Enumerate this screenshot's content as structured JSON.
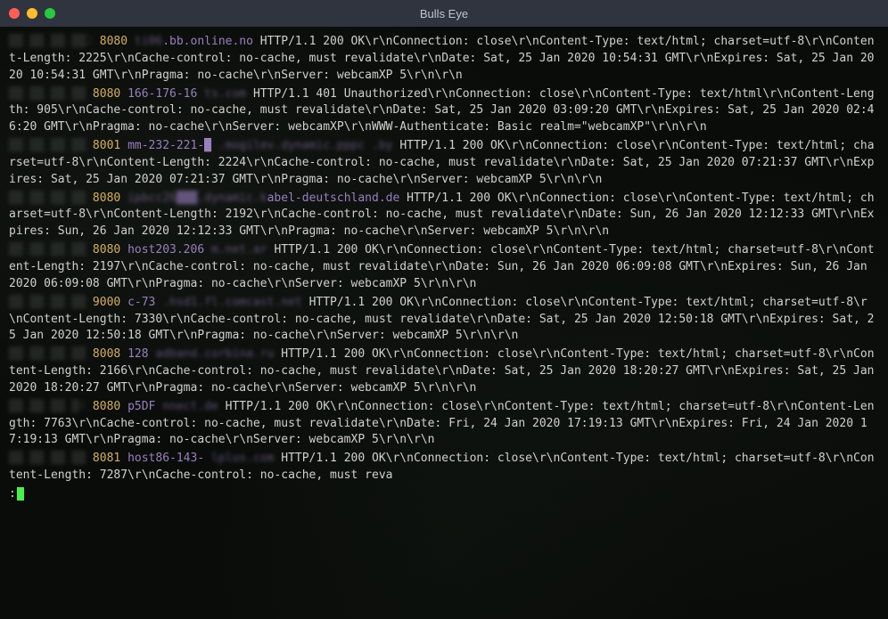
{
  "window": {
    "title": "Bulls Eye"
  },
  "entries": [
    {
      "ip": "██.██.██.██2",
      "port": "8080",
      "host_blur": "ti06",
      "host_clear": ".bb.online.no",
      "host_pad": "            ",
      "response": "HTTP/1.1 200 OK\\r\\nConnection: close\\r\\nContent-Type: text/html; charset=utf-8\\r\\nContent-Length: 2225\\r\\nCache-control: no-cache, must revalidate\\r\\nDate: Sat, 25 Jan 2020 10:54:31 GMT\\r\\nExpires: Sat, 25 Jan 2020 10:54:31 GMT\\r\\nPragma: no-cache\\r\\nServer: webcamXP 5\\r\\n\\r\\n"
    },
    {
      "ip": "██.██.██.██ ",
      "port": "8080",
      "host_blur": "",
      "host_clear": "166-176-16",
      "host_pad": "          ts.com        ",
      "response": "HTTP/1.1 401 Unauthorized\\r\\nConnection: close\\r\\nContent-Type: text/html\\r\\nContent-Length: 905\\r\\nCache-control: no-cache, must revalidate\\r\\nDate: Sat, 25 Jan 2020 03:09:20 GMT\\r\\nExpires: Sat, 25 Jan 2020 02:46:20 GMT\\r\\nPragma: no-cache\\r\\nServer: webcamXP\\r\\nWWW-Authenticate: Basic realm=\"webcamXP\"\\r\\n\\r\\n"
    },
    {
      "ip": "██.██.██.██ ",
      "port": "8001",
      "host_blur": "",
      "host_clear": "mm-232-221-█",
      "host_pad": "    .mogilev.dynamic.pppc      .by ",
      "response": "HTTP/1.1 200 OK\\r\\nConnection: close\\r\\nContent-Type: text/html; charset=utf-8\\r\\nContent-Length: 2224\\r\\nCache-control: no-cache, must revalidate\\r\\nDate: Sat, 25 Jan 2020 07:21:37 GMT\\r\\nExpires: Sat, 25 Jan 2020 07:21:37 GMT\\r\\nPragma: no-cache\\r\\nServer: webcamXP 5\\r\\n\\r\\n"
    },
    {
      "ip": "██.██.██.██ ",
      "port": "8080",
      "host_blur": "ipbcc26███.dynamic.k",
      "host_clear": "abel-deutschland.de ",
      "host_pad": "",
      "response": "HTTP/1.1 200 OK\\r\\nConnection: close\\r\\nContent-Type: text/html; charset=utf-8\\r\\nContent-Length: 2192\\r\\nCache-control: no-cache, must revalidate\\r\\nDate: Sun, 26 Jan 2020 12:12:33 GMT\\r\\nExpires: Sun, 26 Jan 2020 12:12:33 GMT\\r\\nPragma: no-cache\\r\\nServer: webcamXP 5\\r\\n\\r\\n"
    },
    {
      "ip": "██.██.██.██ ",
      "port": "8080",
      "host_blur": "",
      "host_clear": "host203.206",
      "host_pad": "          m.net.ar            ",
      "response": "HTTP/1.1 200 OK\\r\\nConnection: close\\r\\nContent-Type: text/html; charset=utf-8\\r\\nContent-Length: 2197\\r\\nCache-control: no-cache, must revalidate\\r\\nDate: Sun, 26 Jan 2020 06:09:08 GMT\\r\\nExpires: Sun, 26 Jan 2020 06:09:08 GMT\\r\\nPragma: no-cache\\r\\nServer: webcamXP 5\\r\\n\\r\\n"
    },
    {
      "ip": "██.██.██.██ ",
      "port": "9000",
      "host_blur": "",
      "host_clear": "c-73",
      "host_pad": "        .hsd1.fl.comcast.net       ",
      "response": "HTTP/1.1 200 OK\\r\\nConnection: close\\r\\nContent-Type: text/html; charset=utf-8\\r\\nContent-Length: 7330\\r\\nCache-control: no-cache, must revalidate\\r\\nDate: Sat, 25 Jan 2020 12:50:18 GMT\\r\\nExpires: Sat, 25 Jan 2020 12:50:18 GMT\\r\\nPragma: no-cache\\r\\nServer: webcamXP 5\\r\\n\\r\\n"
    },
    {
      "ip": "██.██.██.██ ",
      "port": "8008",
      "host_blur": "",
      "host_clear": "128",
      "host_pad": "           adband.corbina.ru        ",
      "response": "HTTP/1.1 200 OK\\r\\nConnection: close\\r\\nContent-Type: text/html; charset=utf-8\\r\\nContent-Length: 2166\\r\\nCache-control: no-cache, must revalidate\\r\\nDate: Sat, 25 Jan 2020 18:20:27 GMT\\r\\nExpires: Sat, 25 Jan 2020 18:20:27 GMT\\r\\nPragma: no-cache\\r\\nServer: webcamXP 5\\r\\n\\r\\n"
    },
    {
      "ip": "██.██.██.█0 ",
      "port": "8080",
      "host_blur": "",
      "host_clear": "p5DF",
      "host_pad": "              nnect.de       ",
      "response": "HTTP/1.1 200 OK\\r\\nConnection: close\\r\\nContent-Type: text/html; charset=utf-8\\r\\nContent-Length: 7763\\r\\nCache-control: no-cache, must revalidate\\r\\nDate: Fri, 24 Jan 2020 17:19:13 GMT\\r\\nExpires: Fri, 24 Jan 2020 17:19:13 GMT\\r\\nPragma: no-cache\\r\\nServer: webcamXP 5\\r\\n\\r\\n"
    },
    {
      "ip": "██.██.██.██ ",
      "port": "8081",
      "host_blur": "",
      "host_clear": "host86-143-",
      "host_pad": "                    lplus.com          ",
      "response": "HTTP/1.1 200 OK\\r\\nConnection: close\\r\\nContent-Type: text/html; charset=utf-8\\r\\nContent-Length: 7287\\r\\nCache-control: no-cache, must reva"
    }
  ],
  "prompt": ":"
}
